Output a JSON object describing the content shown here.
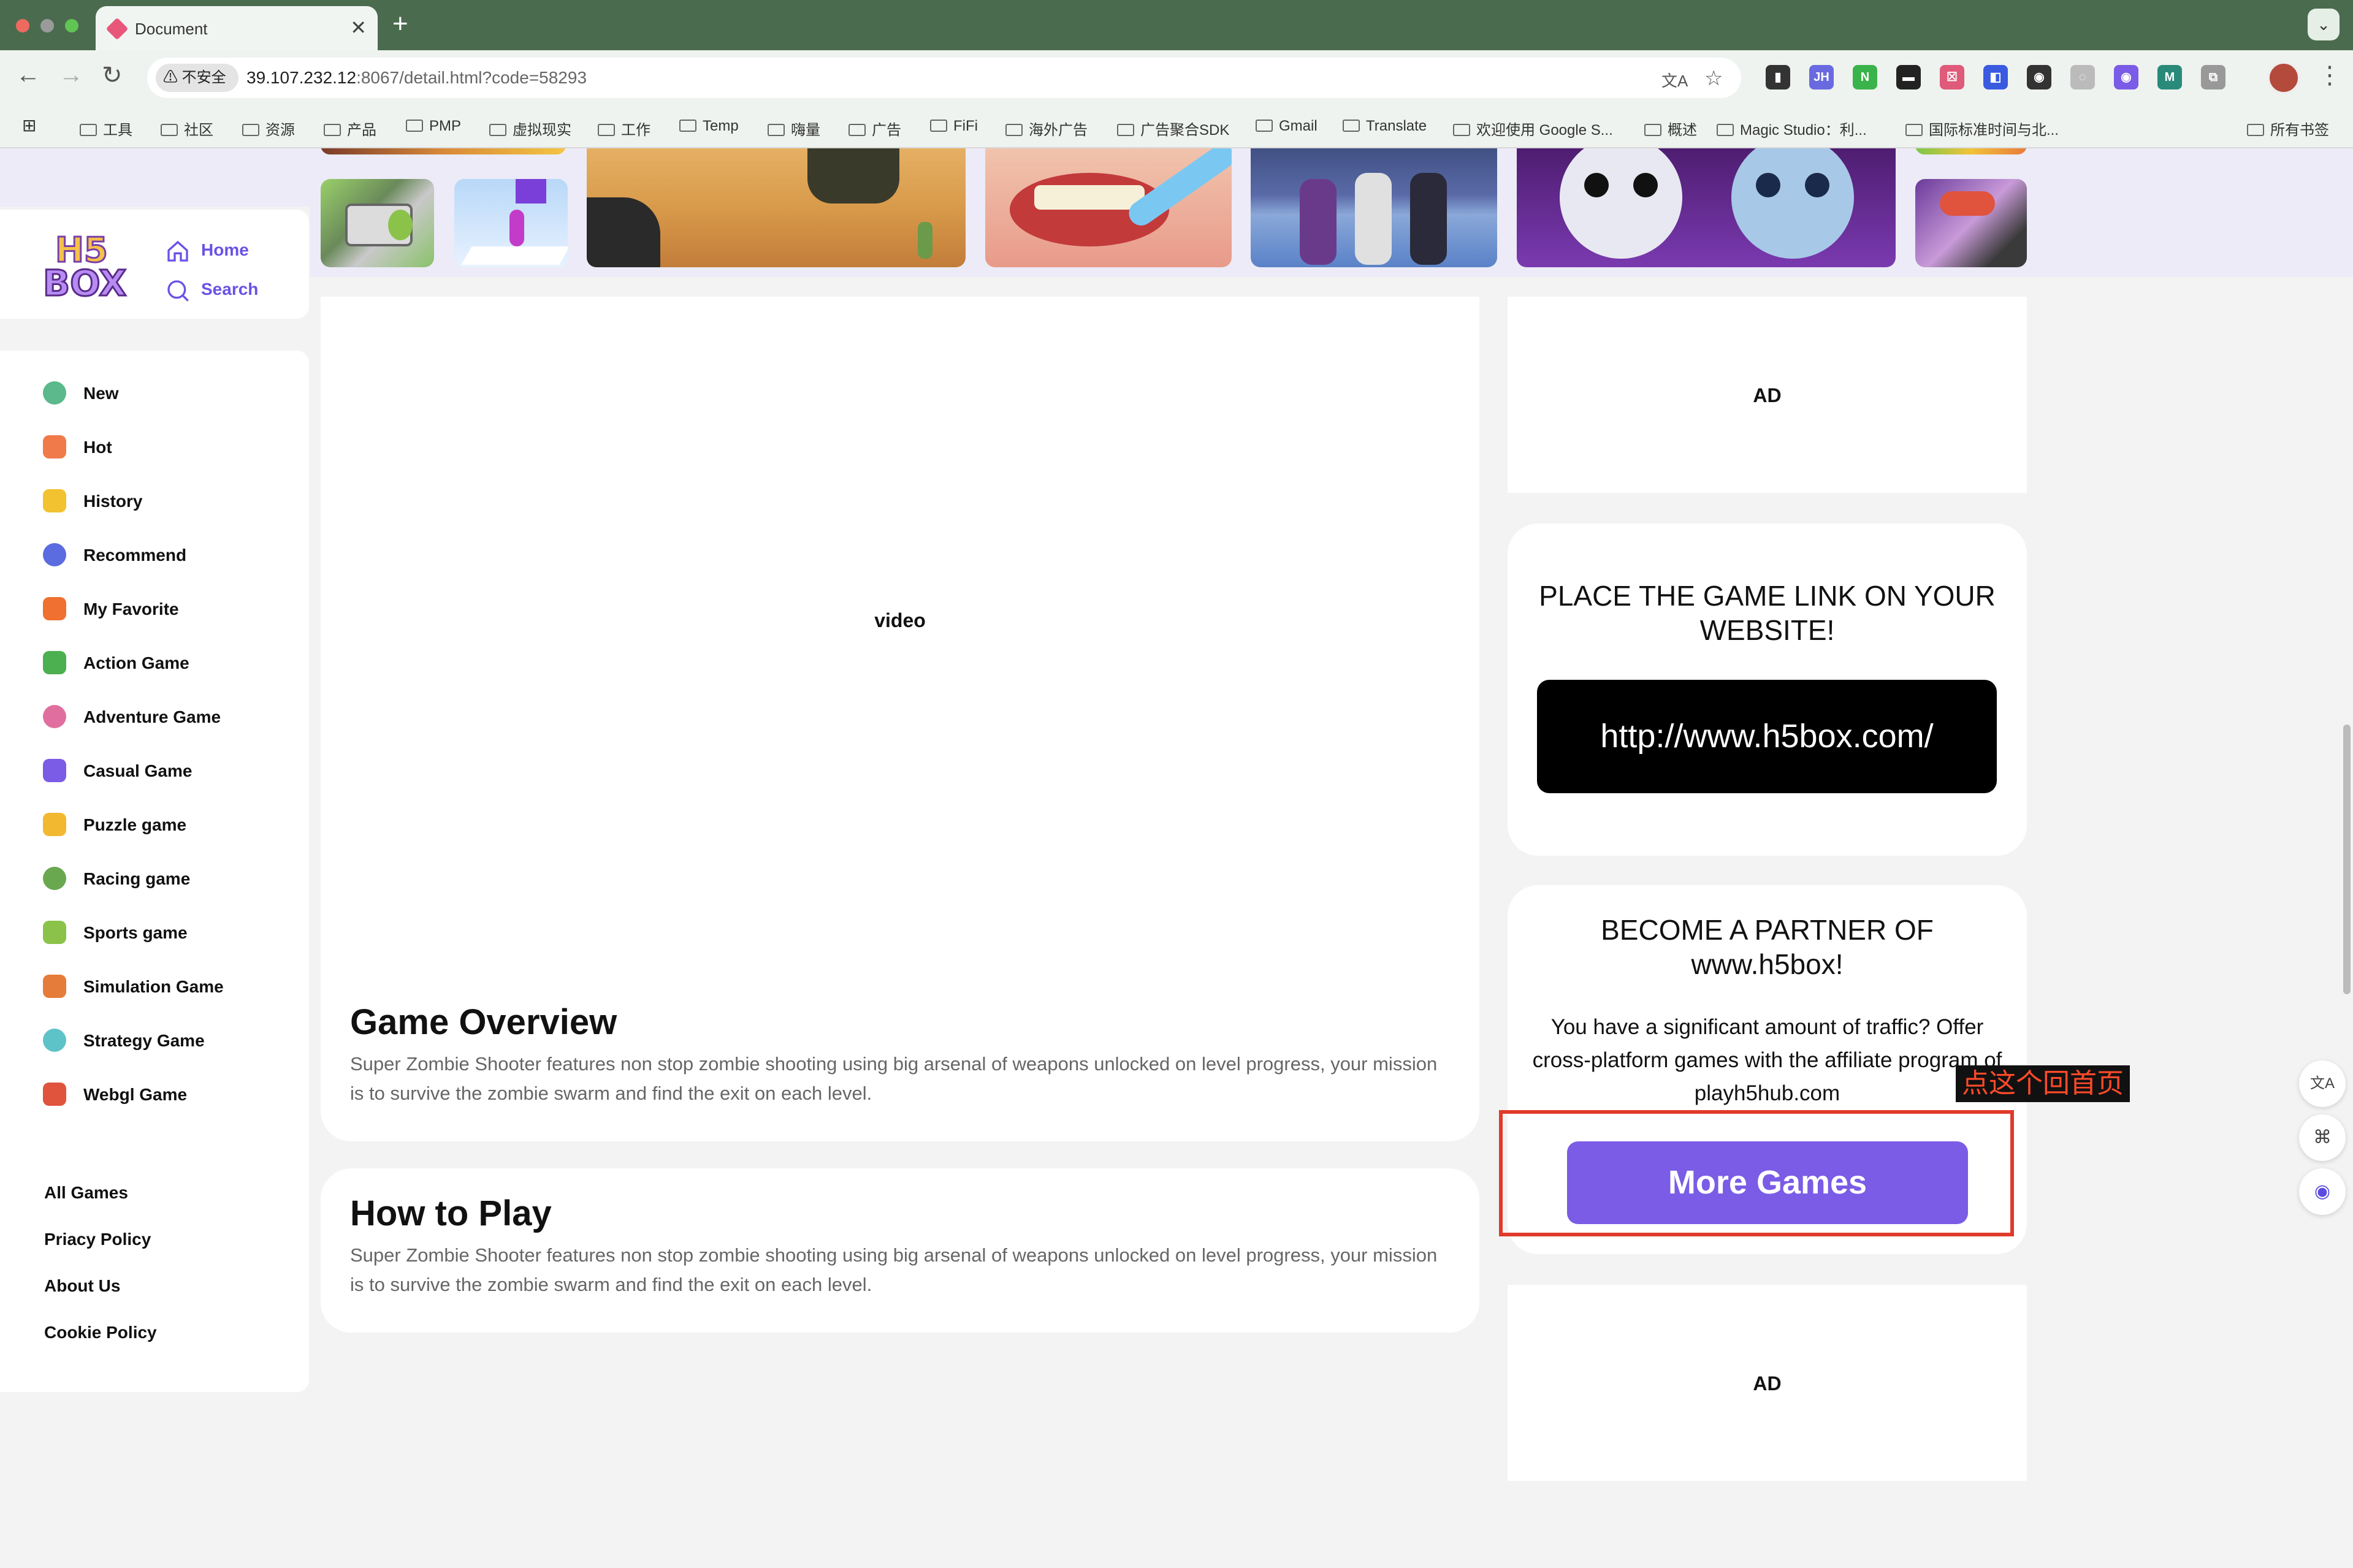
{
  "browser": {
    "tab_title": "Document",
    "tab_close": "✕",
    "new_tab": "+",
    "tab_menu": "⌄",
    "insecure_label": "不安全",
    "url_host": "39.107.232.12",
    "url_rest": ":8067/detail.html?code=58293",
    "back": "←",
    "forward": "→",
    "reload": "↻",
    "translate_icon": "文A",
    "star_icon": "☆",
    "more_icon": "⋮",
    "extensions": [
      "▮",
      "JH",
      "N",
      "▬",
      "☒",
      "◧",
      "◉",
      "◌",
      "◉",
      "M",
      "⧉"
    ],
    "bookmarks": [
      "工具",
      "社区",
      "资源",
      "产品",
      "PMP",
      "虚拟现实",
      "工作",
      "Temp",
      "嗨量",
      "广告",
      "FiFi",
      "海外广告",
      "广告聚合SDK",
      "Gmail",
      "Translate",
      "欢迎使用 Google S...",
      "概述",
      "Magic Studio：利...",
      "国际标准时间与北...",
      "所有书签"
    ],
    "apps_icon": "⊞"
  },
  "site": {
    "logo_top": "H5",
    "logo_bottom": "BOX",
    "nav_home": "Home",
    "nav_search": "Search"
  },
  "sidebar": {
    "items": [
      {
        "label": "New",
        "icon": "new-icon",
        "color": "#5bb98c"
      },
      {
        "label": "Hot",
        "icon": "fire-icon",
        "color": "#f07a4a"
      },
      {
        "label": "History",
        "icon": "history-icon",
        "color": "#f2c230"
      },
      {
        "label": "Recommend",
        "icon": "recommend-icon",
        "color": "#5b6be0"
      },
      {
        "label": "My Favorite",
        "icon": "favorite-icon",
        "color": "#ef7030"
      },
      {
        "label": "Action Game",
        "icon": "action-icon",
        "color": "#4caf50"
      },
      {
        "label": "Adventure Game",
        "icon": "adventure-icon",
        "color": "#e06fa0"
      },
      {
        "label": "Casual Game",
        "icon": "casual-icon",
        "color": "#7a5ce6"
      },
      {
        "label": "Puzzle game",
        "icon": "puzzle-icon",
        "color": "#f2b830"
      },
      {
        "label": "Racing game",
        "icon": "racing-icon",
        "color": "#6aa84f"
      },
      {
        "label": "Sports game",
        "icon": "sports-icon",
        "color": "#8bc34a"
      },
      {
        "label": "Simulation Game",
        "icon": "simulation-icon",
        "color": "#e57c3a"
      },
      {
        "label": "Strategy Game",
        "icon": "strategy-icon",
        "color": "#5ec3c8"
      },
      {
        "label": "Webgl Game",
        "icon": "webgl-icon",
        "color": "#e0533d"
      }
    ],
    "footer_links": [
      "All Games",
      "Priacy Policy",
      "About Us",
      "Cookie Policy"
    ]
  },
  "main": {
    "video_label": "video",
    "overview_title": "Game Overview",
    "overview_text": "Super Zombie Shooter features non stop zombie shooting using big arsenal of weapons unlocked on level progress, your mission is to survive the zombie swarm and find the exit on each level.",
    "howto_title": "How to Play",
    "howto_text": "Super Zombie Shooter features non stop zombie shooting using big arsenal of weapons unlocked on level progress, your mission is to survive the zombie swarm and find the exit on each level."
  },
  "right": {
    "ad_top": "AD",
    "place_link_title": "PLACE THE GAME LINK ON YOUR WEBSITE!",
    "link_url": "http://www.h5box.com/",
    "partner_title": "BECOME A PARTNER OF www.h5box!",
    "partner_text": "You have a significant amount of traffic? Offer cross-platform games with the affiliate program of playh5hub.com",
    "more_games": "More Games",
    "ad_bottom": "AD"
  },
  "annotation": {
    "text": "点这个回首页",
    "color": "#e03a2a"
  },
  "floating": {
    "translate": "文A",
    "grid": "⌘",
    "assistant": "◉"
  },
  "colors": {
    "accent": "#7a5ce6",
    "tabbar": "#4b6b4f",
    "band": "#ecebf7"
  }
}
